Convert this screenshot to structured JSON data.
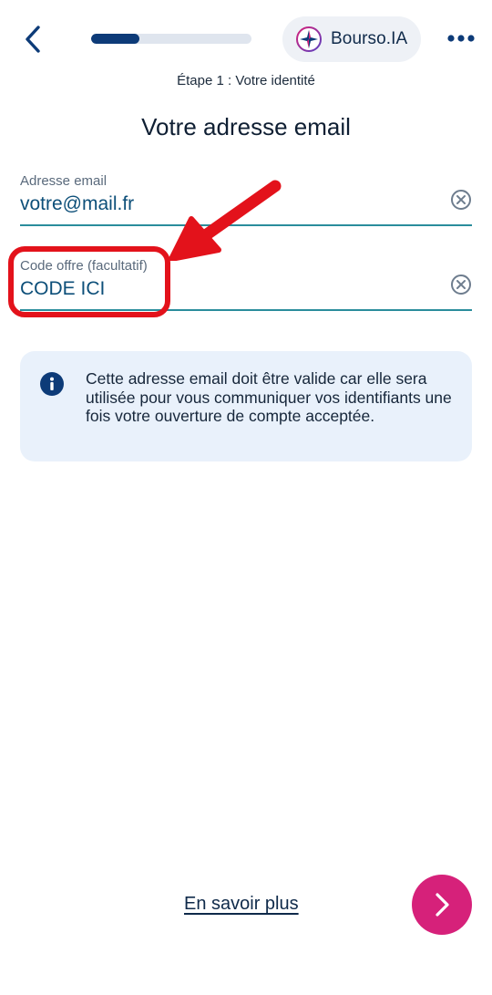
{
  "header": {
    "back_icon": "chevron-left-icon",
    "progress_percent": 30,
    "progress_color": "#0d3b78",
    "ia_label": "Bourso.IA",
    "ia_icon": "sparkle-icon",
    "more_icon": "more-dots-icon"
  },
  "step_label": "Étape 1 : Votre identité",
  "title": "Votre adresse email",
  "fields": {
    "email": {
      "label": "Adresse email",
      "value": "votre@mail.fr",
      "clear_icon": "clear-icon"
    },
    "offer_code": {
      "label": "Code offre (facultatif)",
      "value": "CODE ICI",
      "clear_icon": "clear-icon"
    }
  },
  "info": {
    "icon": "info-icon",
    "text": "Cette adresse email doit être valide car elle sera utilisée pour vous communiquer vos identifiants une fois votre ouverture de compte acceptée."
  },
  "footer": {
    "learn_more": "En savoir plus",
    "next_icon": "chevron-right-icon",
    "next_color": "#d6217a"
  },
  "colors": {
    "accent": "#2a8d9c",
    "annotation": "#e3121b",
    "info_bg": "#e9f1fb"
  }
}
